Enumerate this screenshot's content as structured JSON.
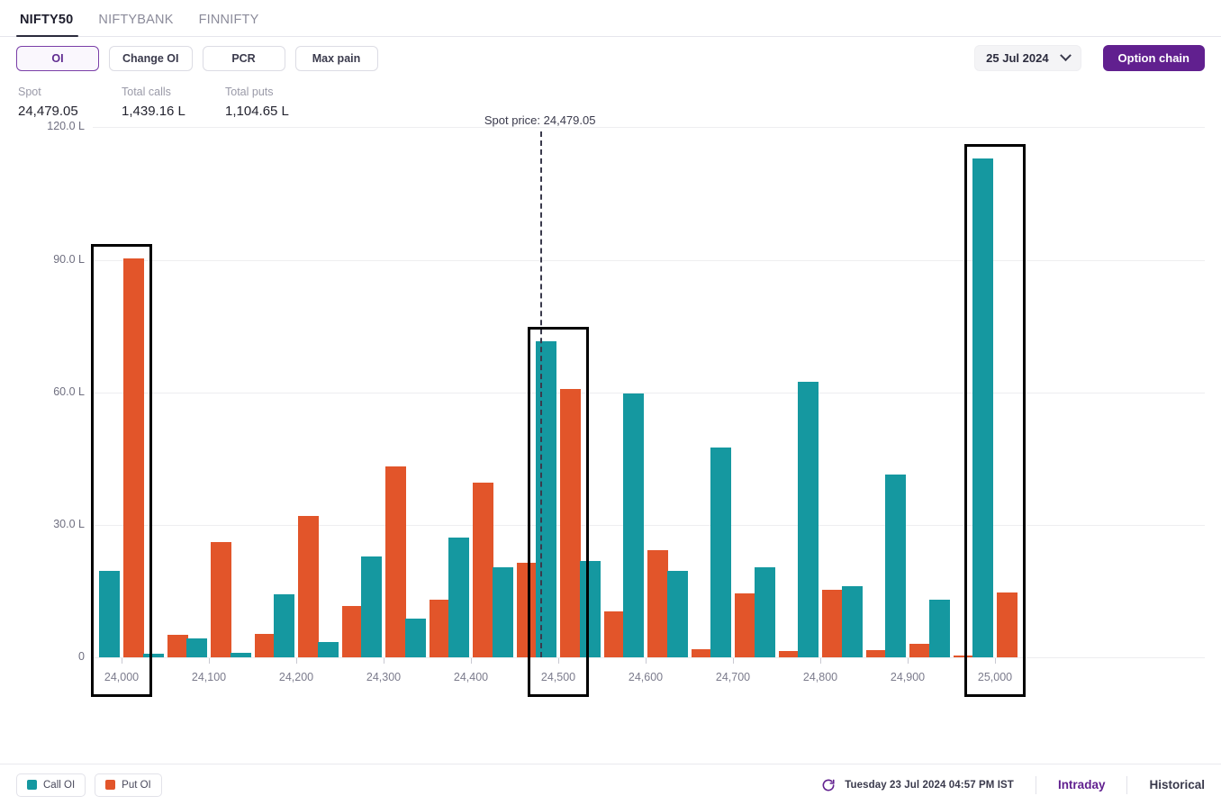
{
  "tabs": [
    {
      "label": "NIFTY50",
      "active": true
    },
    {
      "label": "NIFTYBANK",
      "active": false
    },
    {
      "label": "FINNIFTY",
      "active": false
    }
  ],
  "toolbar": {
    "buttons": [
      {
        "label": "OI",
        "selected": true
      },
      {
        "label": "Change OI",
        "selected": false
      },
      {
        "label": "PCR",
        "selected": false
      },
      {
        "label": "Max pain",
        "selected": false
      }
    ],
    "expiry_value": "25 Jul 2024",
    "expiry_icon": "chevron-down-icon",
    "option_chain_label": "Option chain"
  },
  "stats": [
    {
      "label": "Spot",
      "value": "24,479.05"
    },
    {
      "label": "Total calls",
      "value": "1,439.16 L"
    },
    {
      "label": "Total puts",
      "value": "1,104.65 L"
    }
  ],
  "legend": [
    {
      "label": "Call OI",
      "color": "#1598a0"
    },
    {
      "label": "Put OI",
      "color": "#e2552a"
    }
  ],
  "footer": {
    "refresh_icon": "refresh-icon",
    "timestamp": "Tuesday 23 Jul 2024 04:57 PM IST",
    "links": [
      {
        "label": "Intraday",
        "active": true
      },
      {
        "label": "Historical",
        "active": false
      }
    ]
  },
  "chart_data": {
    "type": "bar",
    "title": "",
    "xlabel": "",
    "ylabel": "",
    "ylim": [
      0,
      120
    ],
    "yticks": [
      0,
      30,
      60,
      90,
      120
    ],
    "ytick_labels": [
      "0",
      "30.0 L",
      "60.0 L",
      "90.0 L",
      "120.0 L"
    ],
    "grid": true,
    "legend_position": "bottom-left",
    "unit": "L",
    "annotations": [
      {
        "type": "vline",
        "label": "Spot price: 24,479.05",
        "x": 24479.05,
        "style": "dashed"
      }
    ],
    "highlighted_strikes": [
      24000,
      24500,
      25000
    ],
    "categories": [
      24000,
      24050,
      24100,
      24150,
      24200,
      24250,
      24300,
      24350,
      24400,
      24450,
      24500,
      24550,
      24600,
      24650,
      24700,
      24750,
      24800,
      24850,
      24900,
      24950,
      25000
    ],
    "xtick_labels": [
      "24,000",
      "24,100",
      "24,200",
      "24,300",
      "24,400",
      "24,500",
      "24,600",
      "24,700",
      "24,800",
      "24,900",
      "25,000"
    ],
    "xtick_values": [
      24000,
      24100,
      24200,
      24300,
      24400,
      24500,
      24600,
      24700,
      24800,
      24900,
      25000
    ],
    "series": [
      {
        "name": "Call OI",
        "color": "#1598a0",
        "values": [
          19.5,
          0.9,
          4.2,
          1.0,
          14.3,
          3.5,
          22.9,
          8.8,
          27.2,
          20.3,
          71.5,
          21.9,
          59.8,
          19.5,
          47.6,
          20.3,
          62.3,
          16.2,
          41.4,
          13.1,
          113.0
        ]
      },
      {
        "name": "Put OI",
        "color": "#e2552a",
        "values": [
          90.3,
          5.0,
          26.2,
          5.4,
          32.1,
          11.7,
          43.2,
          13.0,
          39.5,
          21.5,
          60.8,
          10.4,
          24.2,
          1.8,
          14.4,
          1.4,
          15.2,
          1.7,
          3.0,
          0.4,
          14.7
        ]
      }
    ]
  }
}
